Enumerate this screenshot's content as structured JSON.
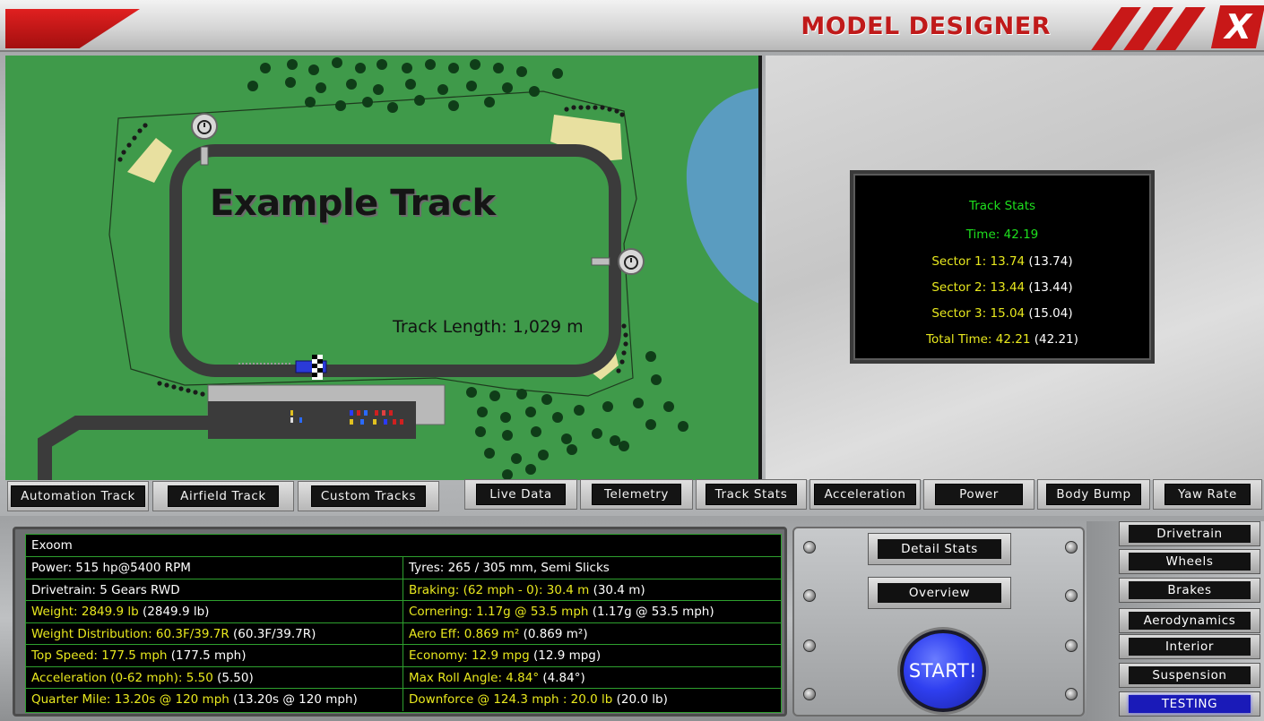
{
  "header": {
    "title": "MODEL DESIGNER",
    "close_label": "X"
  },
  "map": {
    "track_name": "Example Track",
    "track_length": "Track Length: 1,029 m"
  },
  "track_stats": {
    "title": "Track Stats",
    "time_label": "Time: ",
    "time_value": "42.19",
    "sectors": [
      {
        "label": "Sector 1: ",
        "value": "13.74",
        "best": " (13.74)"
      },
      {
        "label": "Sector 2: ",
        "value": "13.44",
        "best": " (13.44)"
      },
      {
        "label": "Sector 3: ",
        "value": "15.04",
        "best": " (15.04)"
      }
    ],
    "total_label": "Total Time: ",
    "total_value": "42.21",
    "total_best": " (42.21)"
  },
  "track_tabs": [
    "Automation Track",
    "Airfield Track",
    "Custom Tracks"
  ],
  "data_tabs": [
    "Live Data",
    "Telemetry",
    "Track Stats",
    "Acceleration",
    "Power",
    "Body Bump",
    "Yaw Rate"
  ],
  "car": {
    "name": "Exoom",
    "rows": [
      {
        "left": "Power: 515 hp@5400 RPM",
        "left_extra": "",
        "left_color": "white",
        "right": "Tyres: 265 / 305 mm, Semi Slicks",
        "right_extra": "",
        "right_color": "white"
      },
      {
        "left": "Drivetrain: 5 Gears RWD",
        "left_extra": "",
        "left_color": "white",
        "right": "Braking: (62 mph - 0): 30.4 m",
        "right_extra": " (30.4 m)",
        "right_color": "yellow"
      },
      {
        "left": "Weight: 2849.9 lb",
        "left_extra": " (2849.9 lb)",
        "left_color": "yellow",
        "right": "Cornering: 1.17g @ 53.5 mph",
        "right_extra": " (1.17g @ 53.5 mph)",
        "right_color": "yellow"
      },
      {
        "left": "Weight Distribution: 60.3F/39.7R",
        "left_extra": " (60.3F/39.7R)",
        "left_color": "yellow",
        "right": "Aero Eff: 0.869 m²",
        "right_extra": " (0.869 m²)",
        "right_color": "yellow"
      },
      {
        "left": "Top Speed: 177.5 mph",
        "left_extra": " (177.5 mph)",
        "left_color": "yellow",
        "right": "Economy: 12.9 mpg",
        "right_extra": " (12.9 mpg)",
        "right_color": "yellow"
      },
      {
        "left": "Acceleration (0-62 mph): 5.50",
        "left_extra": " (5.50)",
        "left_color": "yellow",
        "right": "Max Roll Angle: 4.84°",
        "right_extra": " (4.84°)",
        "right_color": "yellow"
      },
      {
        "left": "Quarter Mile: 13.20s @ 120 mph",
        "left_extra": " (13.20s @ 120 mph)",
        "left_color": "yellow",
        "right": "Downforce @ 124.3 mph : 20.0 lb",
        "right_extra": " (20.0 lb)",
        "right_color": "yellow"
      }
    ]
  },
  "mid": {
    "detail_stats": "Detail Stats",
    "overview": "Overview",
    "start": "START!"
  },
  "side_menu": [
    {
      "label": "Drivetrain",
      "active": false
    },
    {
      "label": "Wheels",
      "active": false
    },
    {
      "label": "Brakes",
      "active": false
    },
    {
      "label": "Aerodynamics",
      "active": false
    },
    {
      "label": "Interior",
      "active": false
    },
    {
      "label": "Suspension",
      "active": false
    },
    {
      "label": "TESTING",
      "active": true
    }
  ],
  "colors": {
    "accent_red": "#c81818",
    "stat_green": "#1ee01e",
    "stat_yellow": "#e8e81e",
    "grass": "#3f9a4a",
    "start_blue": "#2f3ff0"
  }
}
